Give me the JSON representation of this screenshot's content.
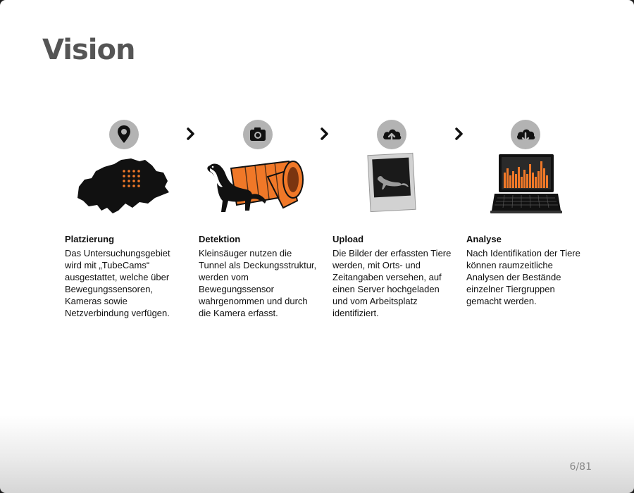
{
  "slide": {
    "title": "Vision",
    "page_number": "6/81"
  },
  "colors": {
    "title": "#555555",
    "accent_orange": "#f07828",
    "badge_grey": "#b3b3b3",
    "ink": "#111111"
  },
  "steps": [
    {
      "title": "Platzierung",
      "description": "Das Untersuchungsgebiet wird mit „TubeCams“ ausgestattet, welche über Bewegungssensoren, Kameras sowie Netzverbindung verfügen.",
      "badge_icon": "map-pin-icon",
      "illustration": "switzerland-map"
    },
    {
      "title": "Detektion",
      "description": "Kleinsäuger nutzen die Tunnel als Deckungsstruktur, werden vom Bewegungssensor wahrgenommen und durch die Kamera erfasst.",
      "badge_icon": "camera-icon",
      "illustration": "weasel-with-tunnel"
    },
    {
      "title": "Upload",
      "description": "Die Bilder der erfassten Tiere werden, mit Orts- und Zeitangaben versehen, auf einen Server hochgeladen und vom Arbeitsplatz identifiziert.",
      "badge_icon": "cloud-upload-icon",
      "illustration": "polaroid-photo"
    },
    {
      "title": "Analyse",
      "description": "Nach Identifikation der Tiere können raumzeitliche Analysen der Bestände einzelner Tiergruppen gemacht werden.",
      "badge_icon": "cloud-download-icon",
      "illustration": "laptop-chart"
    }
  ]
}
